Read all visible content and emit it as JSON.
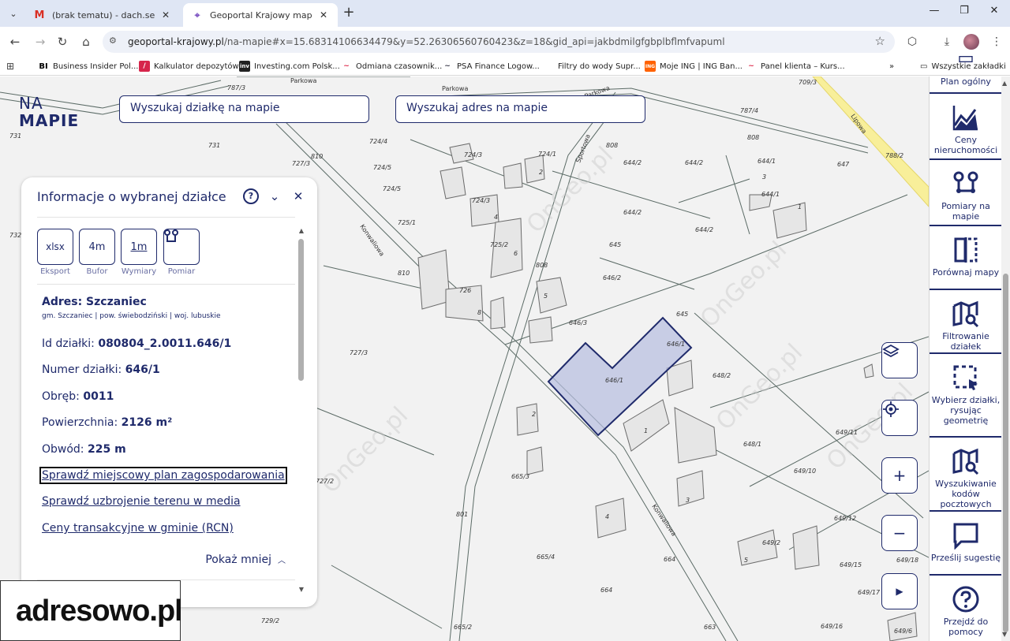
{
  "browser": {
    "tabs": [
      {
        "title": "(brak tematu) - dach.serwis@gm",
        "favicon": "gmail-icon"
      },
      {
        "title": "Geoportal Krajowy mapy i infor",
        "favicon": "map-pin-icon"
      }
    ],
    "url_host": "geoportal-krajowy.pl",
    "url_path": "/na-mapie#x=15.68314106634479&y=52.26306560760423&z=18&gid_api=jakbdmilgfgbplbflmfvapuml",
    "bookmarks": [
      {
        "label": "Business Insider Pol...",
        "icon": "BI"
      },
      {
        "label": "Kalkulator depozytów",
        "icon": "/"
      },
      {
        "label": "Investing.com Polsk...",
        "icon": "inv"
      },
      {
        "label": "Odmiana czasownik...",
        "icon": "~"
      },
      {
        "label": "PSA Finance Logow...",
        "icon": "~"
      },
      {
        "label": "Filtry do wody Supr...",
        "icon": ""
      },
      {
        "label": "Moje ING | ING Ban...",
        "icon": "ING"
      },
      {
        "label": "Panel klienta – Kurs...",
        "icon": "~"
      }
    ],
    "all_bookmarks": "Wszystkie zakładki",
    "colors": {
      "tabbar": "#dfe6f4",
      "omnibox": "#eef1f8"
    }
  },
  "map": {
    "logo_line1": "NA",
    "logo_line2": "MAPIE",
    "search_plot": "Wyszukaj działkę na mapie",
    "search_address": "Wyszukaj adres na mapie",
    "street_labels": [
      "Parkowa",
      "Parkowa",
      "Sportowa",
      "Konwaliowa",
      "Konwaliowa",
      "Lipowa"
    ],
    "parcel_labels": [
      "787/3",
      "709/3",
      "787/4",
      "731",
      "731",
      "732",
      "724/4",
      "727/3",
      "810",
      "808",
      "808",
      "724/3",
      "724/1",
      "724/5",
      "724/5",
      "644/2",
      "644/2",
      "644/1",
      "644/1",
      "647",
      "788/2",
      "724/3",
      "725/1",
      "644/2",
      "644/2",
      "725/2",
      "645",
      "810",
      "808",
      "646/2",
      "726",
      "645",
      "646/3",
      "646/1",
      "646/1",
      "648/2",
      "727/3",
      "648/1",
      "649/11",
      "727/2",
      "665/3",
      "649/10",
      "801",
      "649/12",
      "665/4",
      "664",
      "649/15",
      "649/18",
      "664",
      "649/17",
      "729/2",
      "665/2",
      "663",
      "649/16",
      "649/6",
      "649/2"
    ],
    "building_numbers": [
      "2",
      "4",
      "6",
      "8",
      "5",
      "1",
      "3",
      "2",
      "1",
      "3",
      "4",
      "5"
    ],
    "watermark": "OnGeo.pl",
    "selected_plot_color": "#1f2a6b"
  },
  "info_panel": {
    "title": "Informacje o wybranej działce",
    "tools": [
      {
        "icon": "xlsx",
        "label": "Eksport"
      },
      {
        "icon": "4m",
        "label": "Bufor"
      },
      {
        "icon": "1m",
        "label": "Wymiary"
      },
      {
        "icon": "measure-icon",
        "label": "Pomiar"
      }
    ],
    "address_label": "Adres: Szczaniec",
    "address_sub": "gm. Szczaniec | pow. świebodziński | woj. lubuskie",
    "fields": [
      {
        "label": "Id działki:",
        "value": "080804_2.0011.646/1"
      },
      {
        "label": "Numer działki:",
        "value": "646/1"
      },
      {
        "label": "Obręb:",
        "value": "0011"
      },
      {
        "label": "Powierzchnia:",
        "value": "2126 m²"
      },
      {
        "label": "Obwód:",
        "value": "225 m"
      }
    ],
    "links": [
      "Sprawdź miejscowy plan zagospodarowania",
      "Sprawdź uzbrojenie terenu w media",
      "Ceny transakcyjne w gminie (RCN)"
    ],
    "show_less": "Pokaż mniej"
  },
  "ad": {
    "text": "adresowo.pl"
  },
  "sidebar": {
    "items": [
      {
        "label": "Plan ogólny",
        "icon": "plan-icon"
      },
      {
        "label": "Ceny nieruchomości",
        "icon": "chart-icon"
      },
      {
        "label": "Pomiary na mapie",
        "icon": "measure-icon"
      },
      {
        "label": "Porównaj mapy",
        "icon": "compare-icon"
      },
      {
        "label": "Filtrowanie działek",
        "icon": "map-filter-icon"
      },
      {
        "label": "Wybierz działki, rysując geometrię",
        "icon": "select-area-icon"
      },
      {
        "label": "Wyszukiwanie kodów pocztowych",
        "icon": "map-search-icon"
      },
      {
        "label": "Prześlij sugestię",
        "icon": "message-icon"
      },
      {
        "label": "Przejdź do pomocy",
        "icon": "help-icon"
      }
    ]
  }
}
